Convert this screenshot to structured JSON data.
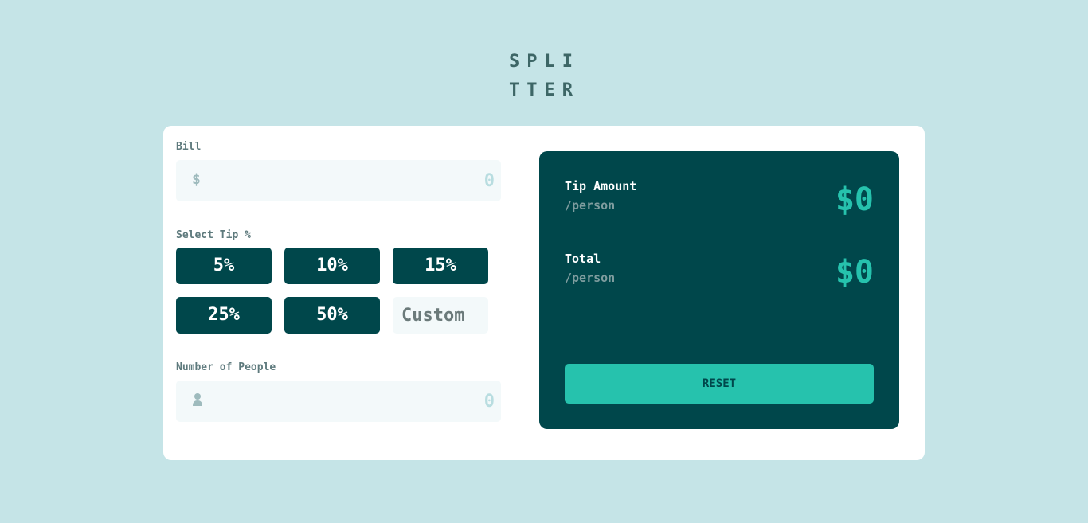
{
  "logo": {
    "line1": "SPLI",
    "line2": "TTER"
  },
  "bill": {
    "label": "Bill",
    "icon": "dollar-icon",
    "icon_glyph": "$",
    "placeholder": "0",
    "value": ""
  },
  "tip": {
    "label": "Select Tip %",
    "options": [
      "5%",
      "10%",
      "15%",
      "25%",
      "50%"
    ],
    "custom_placeholder": "Custom"
  },
  "people": {
    "label": "Number of People",
    "icon": "person-icon",
    "placeholder": "0",
    "value": ""
  },
  "results": {
    "tip_amount": {
      "title": "Tip Amount",
      "sub": "/person",
      "value": "$0"
    },
    "total": {
      "title": "Total",
      "sub": "/person",
      "value": "$0"
    },
    "reset_label": "RESET"
  },
  "colors": {
    "background": "#c5e4e7",
    "dark_cyan": "#00474b",
    "strong_cyan": "#26c2ad",
    "input_bg": "#f3f9fa",
    "label_gray": "#5e7a7d"
  }
}
